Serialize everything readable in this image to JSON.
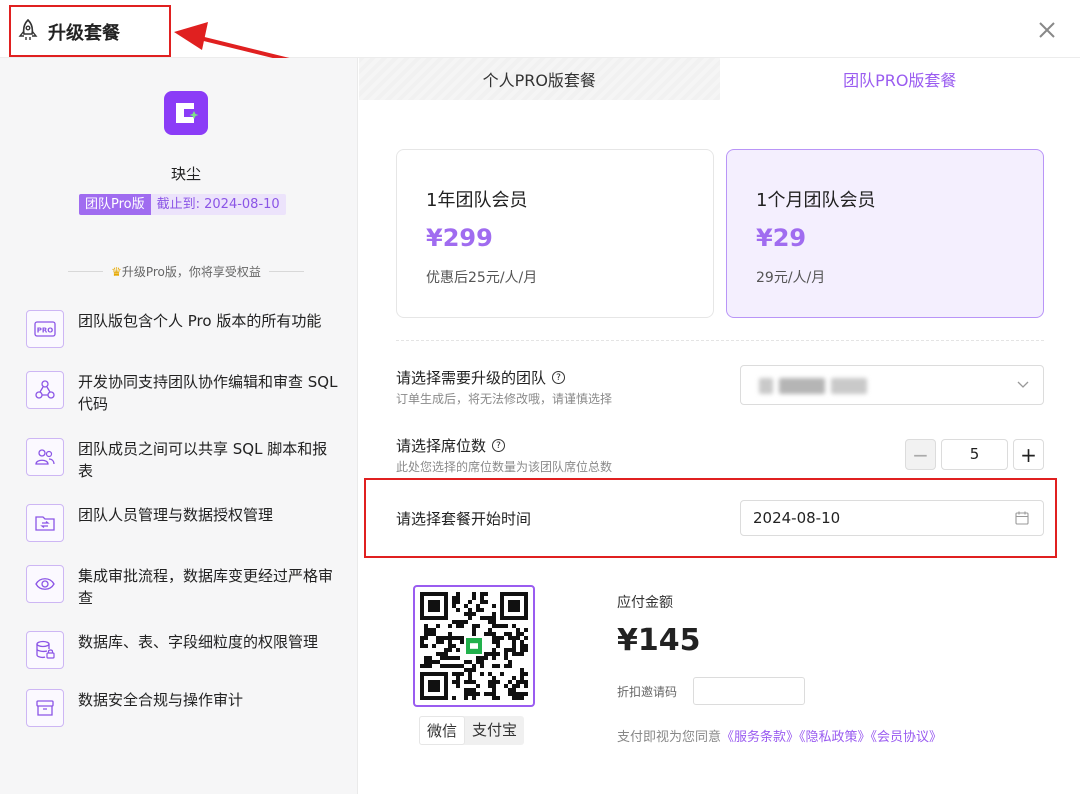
{
  "header": {
    "title": "升级套餐",
    "title_icon": "rocket-icon",
    "close_icon": "close-icon",
    "annotation_color": "#e02020"
  },
  "sidebar": {
    "app_name": "玦尘",
    "plan_badge": "团队Pro版",
    "expiry": "截止到: 2024-08-10",
    "upgrade_hint": "升级Pro版，你将享受权益",
    "features": [
      {
        "icon": "pro-badge-icon",
        "text": "团队版包含个人 Pro 版本的所有功能"
      },
      {
        "icon": "collaboration-icon",
        "text": "开发协同支持团队协作编辑和审查 SQL 代码"
      },
      {
        "icon": "team-members-icon",
        "text": "团队成员之间可以共享 SQL 脚本和报表"
      },
      {
        "icon": "folder-sync-icon",
        "text": "团队人员管理与数据授权管理"
      },
      {
        "icon": "eye-icon",
        "text": "集成审批流程，数据库变更经过严格审查"
      },
      {
        "icon": "database-lock-icon",
        "text": "数据库、表、字段细粒度的权限管理"
      },
      {
        "icon": "archive-box-icon",
        "text": "数据安全合规与操作审计"
      }
    ]
  },
  "tabs": [
    {
      "label": "个人PRO版套餐",
      "active": false
    },
    {
      "label": "团队PRO版套餐",
      "active": true
    }
  ],
  "plans": [
    {
      "name": "1年团队会员",
      "price": "¥299",
      "note": "优惠后25元/人/月",
      "selected": false
    },
    {
      "name": "1个月团队会员",
      "price": "¥29",
      "note": "29元/人/月",
      "selected": true
    }
  ],
  "form": {
    "team_label": "请选择需要升级的团队",
    "team_hint": "订单生成后，将无法修改哦，请谨慎选择",
    "seats_label": "请选择席位数",
    "seats_hint": "此处您选择的席位数量为该团队席位总数",
    "seats_value": "5",
    "start_label": "请选择套餐开始时间",
    "start_value": "2024-08-10"
  },
  "payment": {
    "methods": [
      "微信",
      "支付宝"
    ],
    "active_method": "微信",
    "amount_label": "应付金额",
    "amount": "¥145",
    "coupon_label": "折扣邀请码",
    "coupon_value": "",
    "terms_prefix": "支付即视为您同意",
    "terms_links": [
      "《服务条款》",
      "《隐私政策》",
      "《会员协议》"
    ]
  },
  "colors": {
    "accent": "#9a5cf0",
    "logo": "#8b3cf7",
    "selected_card_bg": "#f4effe"
  }
}
